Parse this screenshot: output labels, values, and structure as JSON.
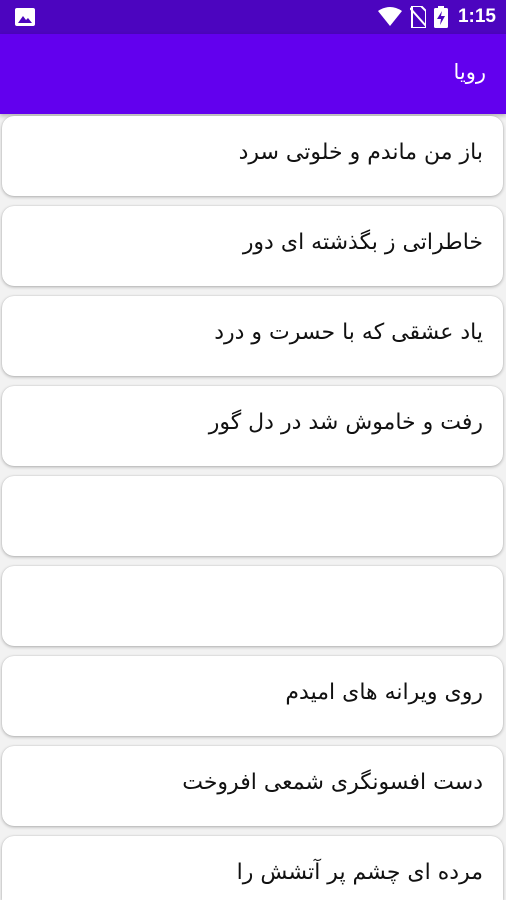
{
  "status_bar": {
    "time": "1:15",
    "icons": [
      "image-icon",
      "wifi-icon",
      "no-sim-icon",
      "battery-charging-icon"
    ]
  },
  "app_bar": {
    "title": "رویا"
  },
  "list": {
    "items": [
      {
        "text": "باز من ماندم و خلوتی سرد"
      },
      {
        "text": "خاطراتی ز بگذشته ای دور"
      },
      {
        "text": "یاد عشقی که با حسرت و درد"
      },
      {
        "text": "رفت و خاموش شد در دل گور"
      },
      {
        "text": ""
      },
      {
        "text": ""
      },
      {
        "text": "روی ویرانه های امیدم"
      },
      {
        "text": "دست افسونگری شمعی افروخت"
      },
      {
        "text": "مرده ای چشم پر آتشش را"
      }
    ]
  },
  "colors": {
    "status_bar": "#4c05bf",
    "app_bar": "#6200ee",
    "background": "#f2f2f2",
    "card": "#ffffff"
  }
}
